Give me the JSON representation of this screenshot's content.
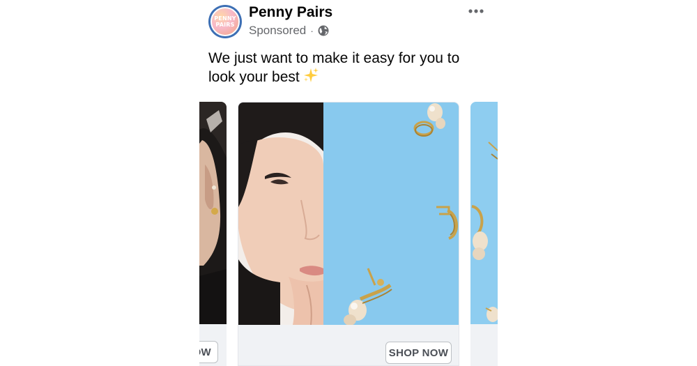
{
  "post": {
    "page_name": "Penny Pairs",
    "sponsored_label": "Sponsored",
    "separator": "·",
    "caption": "We just want to make it easy for you to look your best",
    "caption_emoji": "sparkles-icon"
  },
  "avatar": {
    "logo_text_line1": "PENNY",
    "logo_text_line2": "PAIRS",
    "ring_color": "#3d6fb4"
  },
  "carousel": {
    "left_card_cta_partial": "OW",
    "main_card_cta": "SHOP NOW",
    "card_background": "#f0f2f5",
    "sky_color": "#8ecdf0"
  },
  "icons": {
    "privacy": "globe-icon",
    "menu": "more-options-icon"
  }
}
